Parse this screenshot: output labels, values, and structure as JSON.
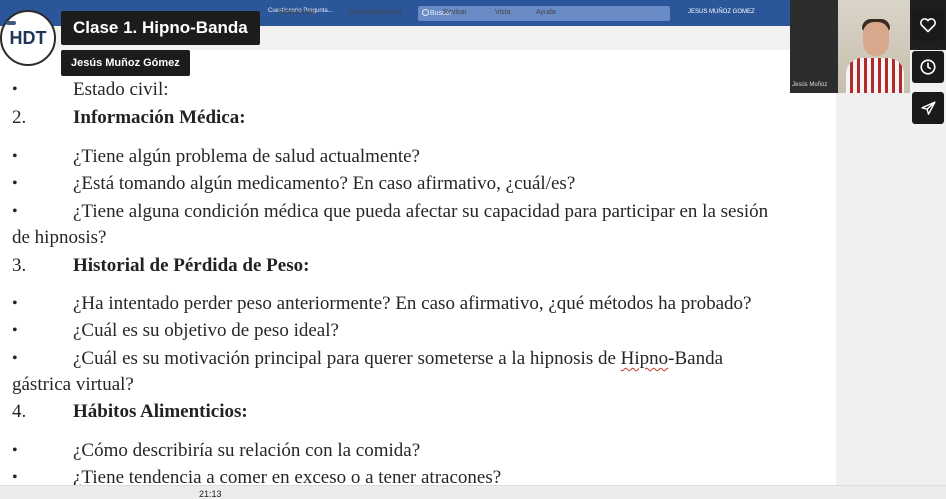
{
  "ribbon": {
    "file_title": "Cuestionario Pregunta...",
    "search_placeholder": "Buscar",
    "user_name": "JESUS MUÑOZ GOMEZ",
    "menu": [
      "Referencias",
      "Correspondencia",
      "Revisar",
      "Vista",
      "Ayuda"
    ]
  },
  "video": {
    "logo_text": "HDT",
    "title": "Clase 1. Hipno-Banda",
    "author": "Jesús Muñoz Gómez",
    "webcam_label": "Jesús Muñoz",
    "timecode": "21:13",
    "icons": [
      "heart-icon",
      "clock-icon",
      "send-icon"
    ]
  },
  "document": {
    "item_estado": "Estado civil:",
    "sec2_num": "2.",
    "sec2_title": "Información Médica:",
    "q_salud": "¿Tiene algún problema de salud actualmente?",
    "q_medic": "¿Está tomando algún medicamento? En caso afirmativo, ¿cuál/es?",
    "q_condicion_1": "¿Tiene alguna condición médica que pueda afectar su capacidad para participar en la sesión",
    "q_condicion_2": "de hipnosis?",
    "sec3_num": "3.",
    "sec3_title": "Historial de Pérdida de Peso:",
    "q_intentado": "¿Ha intentado perder peso anteriormente? En caso afirmativo, ¿qué métodos ha probado?",
    "q_objetivo": "¿Cuál es su objetivo de peso ideal?",
    "q_motivacion_pre": "¿Cuál es su motivación principal para querer someterse a la hipnosis de ",
    "q_motivacion_word": "Hipno",
    "q_motivacion_post": "-Banda",
    "q_motivacion_2": "gástrica virtual?",
    "sec4_num": "4.",
    "sec4_title": "Hábitos Alimenticios:",
    "q_relacion": "¿Cómo describiría su relación con la comida?",
    "q_exceso": "¿Tiene tendencia a comer en exceso o a tener atracones?",
    "bullet_char": "•"
  }
}
